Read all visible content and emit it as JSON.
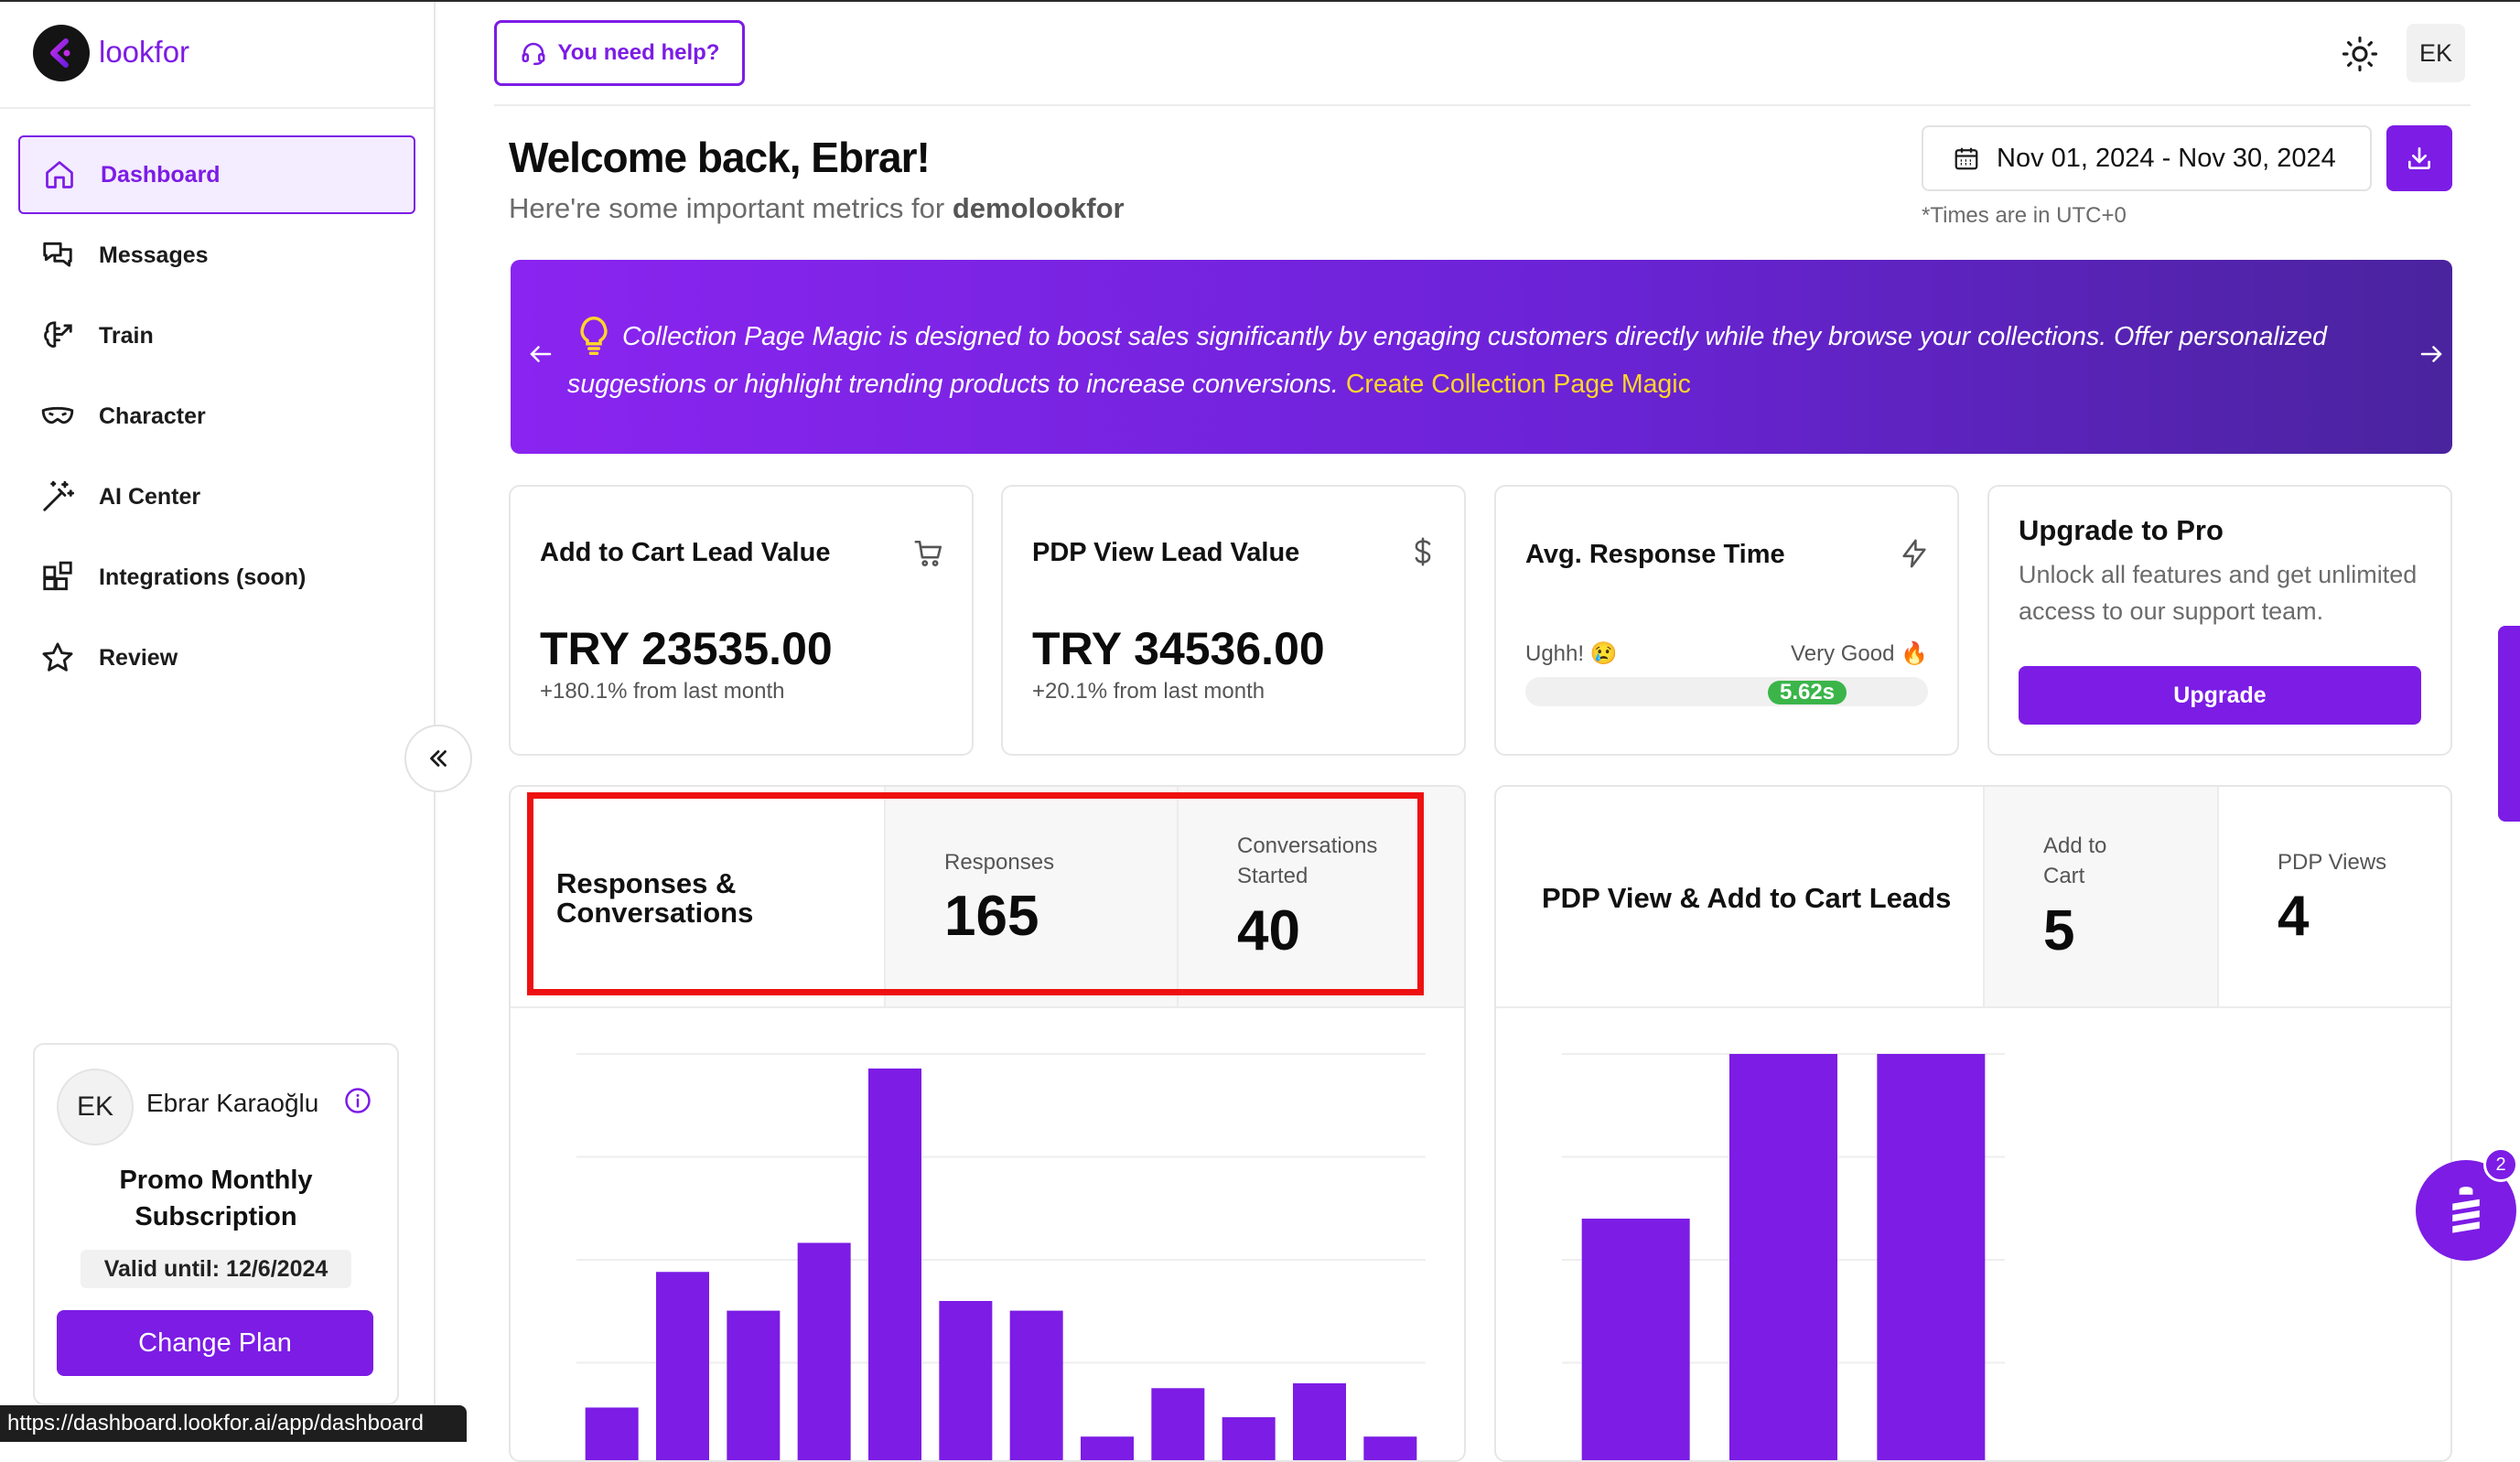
{
  "app": {
    "logo_text": "lookfor"
  },
  "sidebar": {
    "items": [
      {
        "label": "Dashboard",
        "icon": "home-icon",
        "active": true
      },
      {
        "label": "Messages",
        "icon": "chat-bubbles-icon"
      },
      {
        "label": "Train",
        "icon": "brain-icon"
      },
      {
        "label": "Character",
        "icon": "mask-icon"
      },
      {
        "label": "AI Center",
        "icon": "magic-wand-icon"
      },
      {
        "label": "Integrations (soon)",
        "icon": "blocks-icon"
      },
      {
        "label": "Review",
        "icon": "star-icon"
      }
    ],
    "user": {
      "initials": "EK",
      "name": "Ebrar Karaoğlu",
      "plan_line1": "Promo Monthly",
      "plan_line2": "Subscription",
      "valid_until": "Valid until: 12/6/2024",
      "change_plan_label": "Change Plan"
    }
  },
  "status_bar": {
    "url": "https://dashboard.lookfor.ai/app/dashboard"
  },
  "header": {
    "help_label": "You need help?",
    "avatar_initials": "EK",
    "welcome": "Welcome back, Ebrar!",
    "subtitle_prefix": "Here're some important metrics for",
    "store_name": "demolookfor",
    "date_range": "Nov 01, 2024 - Nov 30, 2024",
    "timezone_note": "*Times are in UTC+0"
  },
  "banner": {
    "text": "Collection Page Magic is designed to boost sales significantly by engaging customers directly while they browse your collections. Offer personalized suggestions or highlight trending products to increase conversions.",
    "cta": "Create Collection Page Magic"
  },
  "cards": {
    "add_to_cart": {
      "title": "Add to Cart Lead Value",
      "value": "TRY 23535.00",
      "sub": "+180.1% from last month"
    },
    "pdp_view": {
      "title": "PDP View Lead Value",
      "value": "TRY 34536.00",
      "sub": "+20.1% from last month"
    },
    "response_time": {
      "title": "Avg. Response Time",
      "left_label": "Ughh! 😢",
      "right_label": "Very Good 🔥",
      "value": "5.62s",
      "level": 0.7
    },
    "upgrade": {
      "title": "Upgrade to Pro",
      "text": "Unlock all features and get unlimited access to our support team.",
      "button": "Upgrade"
    }
  },
  "panels": {
    "responses": {
      "title_line1": "Responses &",
      "title_line2": "Conversations",
      "responses_label": "Responses",
      "responses_value": "165",
      "conversations_label_line1": "Conversations",
      "conversations_label_line2": "Started",
      "conversations_value": "40"
    },
    "pdp": {
      "title": "PDP View & Add to Cart Leads",
      "cart_label_line1": "Add to",
      "cart_label_line2": "Cart",
      "cart_value": "5",
      "views_label": "PDP Views",
      "views_value": "4"
    }
  },
  "chat": {
    "badge": "2"
  },
  "colors": {
    "accent": "#7c1ce5",
    "highlight": "#ee1111",
    "cta": "#ffd52b",
    "success": "#3bb54a"
  },
  "chart_data": [
    {
      "type": "bar",
      "panel": "responses",
      "values": [
        12,
        40,
        32,
        46,
        82,
        34,
        32,
        6,
        16,
        10,
        17,
        6
      ],
      "ylim": [
        0,
        85
      ]
    },
    {
      "type": "bar",
      "panel": "pdp",
      "values": [
        3,
        5,
        5
      ],
      "ylim": [
        0,
        5
      ]
    }
  ]
}
